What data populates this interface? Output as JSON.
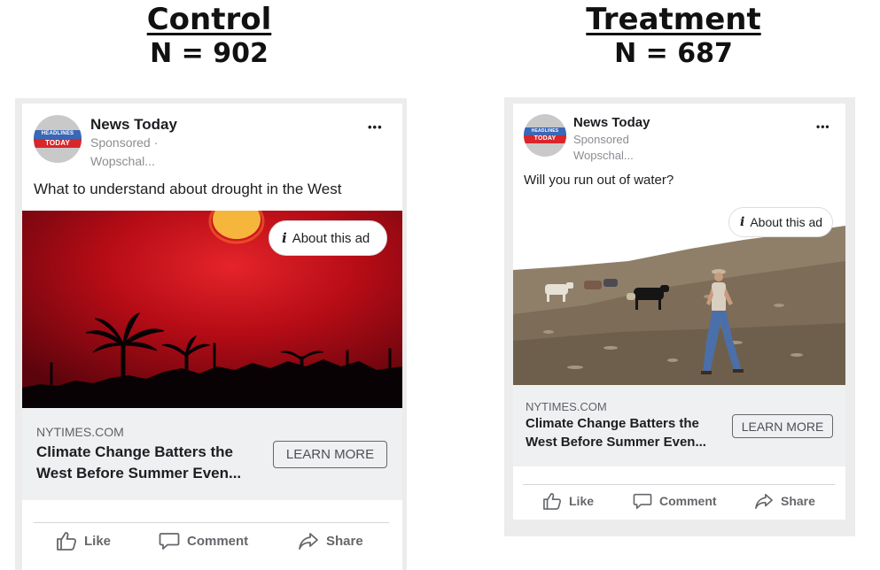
{
  "control": {
    "heading": "Control",
    "n_label": "N = 902",
    "ad": {
      "logo_top": "HEADLINES",
      "logo_bottom": "TODAY",
      "page_name": "News Today",
      "sponsored": "Sponsored ·",
      "paid_by": "Wopschal...",
      "more": "•••",
      "primary_text": "What to understand about drought in the West",
      "about_ad": "About this ad",
      "domain": "NYTIMES.COM",
      "headline_line1": "Climate Change Batters the",
      "headline_line2": "West Before Summer Even...",
      "cta": "LEARN MORE",
      "actions": {
        "like": "Like",
        "comment": "Comment",
        "share": "Share"
      }
    }
  },
  "treatment": {
    "heading": "Treatment",
    "n_label": "N = 687",
    "ad": {
      "logo_top": "HEADLINES",
      "logo_bottom": "TODAY",
      "page_name": "News Today",
      "sponsored": "Sponsored",
      "paid_by": "Wopschal...",
      "more": "•••",
      "primary_text": "Will you run out of water?",
      "about_ad": "About this ad",
      "domain": "NYTIMES.COM",
      "headline_line1": "Climate Change Batters the",
      "headline_line2": "West Before Summer Even...",
      "cta": "LEARN MORE",
      "actions": {
        "like": "Like",
        "comment": "Comment",
        "share": "Share"
      }
    }
  },
  "icons": {
    "like": "thumbs-up-icon",
    "comment": "speech-bubble-icon",
    "share": "share-arrow-icon",
    "info": "info-icon"
  },
  "colors": {
    "link_box": "#eff0f2",
    "secondary_text": "#8a8d91",
    "sunset_red": "#c51018",
    "sun": "#f5b73a"
  }
}
